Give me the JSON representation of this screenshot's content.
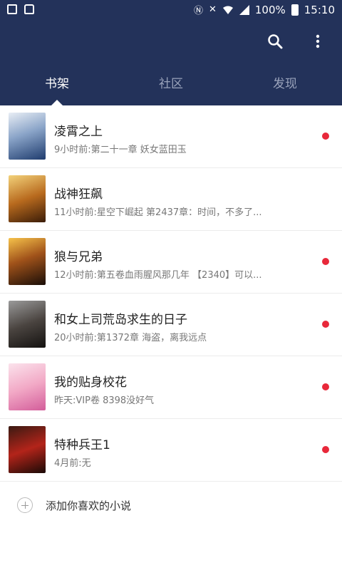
{
  "status_bar": {
    "battery_text": "100%",
    "time": "15:10",
    "icons": [
      "image-icon",
      "bag-icon",
      "nfc-icon",
      "mute-icon",
      "wifi-icon",
      "signal-icon",
      "battery-icon"
    ]
  },
  "toolbar": {
    "icons": [
      "search-icon",
      "more-vertical-icon"
    ]
  },
  "tabs": [
    {
      "label": "书架",
      "active": true
    },
    {
      "label": "社区",
      "active": false
    },
    {
      "label": "发现",
      "active": false
    }
  ],
  "books": [
    {
      "title": "凌霄之上",
      "update": "9小时前:第二十一章  妖女蓝田玉",
      "unread": true
    },
    {
      "title": "战神狂飙",
      "update": "11小时前:星空下崛起 第2437章：时间，不多了...",
      "unread": false
    },
    {
      "title": "狼与兄弟",
      "update": "12小时前:第五卷血雨腥风那几年 【2340】可以...",
      "unread": true
    },
    {
      "title": "和女上司荒岛求生的日子",
      "update": "20小时前:第1372章    海盗，离我远点",
      "unread": true
    },
    {
      "title": "我的贴身校花",
      "update": "昨天:VIP卷 8398没好气",
      "unread": true
    },
    {
      "title": "特种兵王1",
      "update": "4月前:无",
      "unread": true
    }
  ],
  "add_novel": {
    "label": "添加你喜欢的小说"
  },
  "colors": {
    "header": "#23325a",
    "unread_dot": "#e8283a"
  }
}
